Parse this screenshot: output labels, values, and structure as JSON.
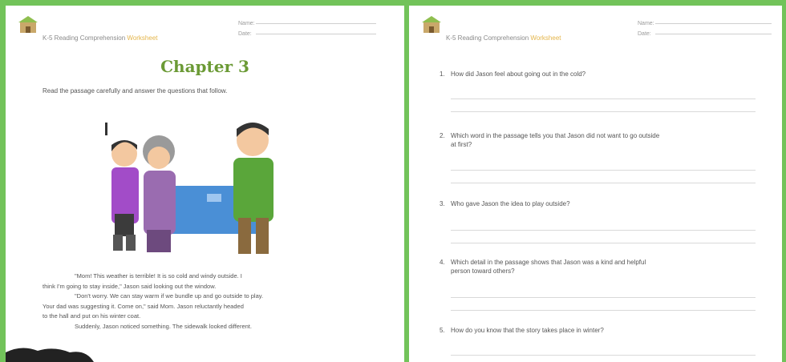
{
  "left_page": {
    "brand": "K-5 Reading Comprehension",
    "brand_accent": "Worksheet",
    "name_label": "Name:",
    "date_label": "Date:",
    "chapter_title": "Chapter 3",
    "instructions": "Read the passage carefully and answer the questions that follow.",
    "passage": [
      "\"Mom! This weather is terrible! It is so cold and windy outside. I",
      "think I'm going to stay inside,\" Jason said looking out the window.",
      "\"Don't worry. We can stay warm if we bundle up and go outside to play.",
      "Your dad was suggesting it. Come on,\" said Mom. Jason reluctantly headed",
      "to the hall and put on his winter coat.",
      "Suddenly, Jason noticed something. The sidewalk looked different."
    ]
  },
  "right_page": {
    "brand": "K-5 Reading Comprehension",
    "brand_accent": "Worksheet",
    "name_label": "Name:",
    "date_label": "Date:",
    "questions": [
      {
        "num": "1.",
        "text": "How did Jason feel about going out in the cold?"
      },
      {
        "num": "2.",
        "text": "Which word in the passage tells you that Jason did not want to go outside",
        "text2": "at first?"
      },
      {
        "num": "3.",
        "text": "Who gave Jason the idea to play outside?"
      },
      {
        "num": "4.",
        "text": "Which detail in the passage shows that Jason was a kind and helpful",
        "text2": "person toward others?"
      },
      {
        "num": "5.",
        "text": "How do you know that the story takes place in winter?"
      }
    ]
  },
  "colors": {
    "border_green": "#72c35a",
    "title_green": "#6b9a35",
    "accent_yellow": "#e4b54a"
  },
  "icons": {
    "logo": "house-logo-icon"
  }
}
